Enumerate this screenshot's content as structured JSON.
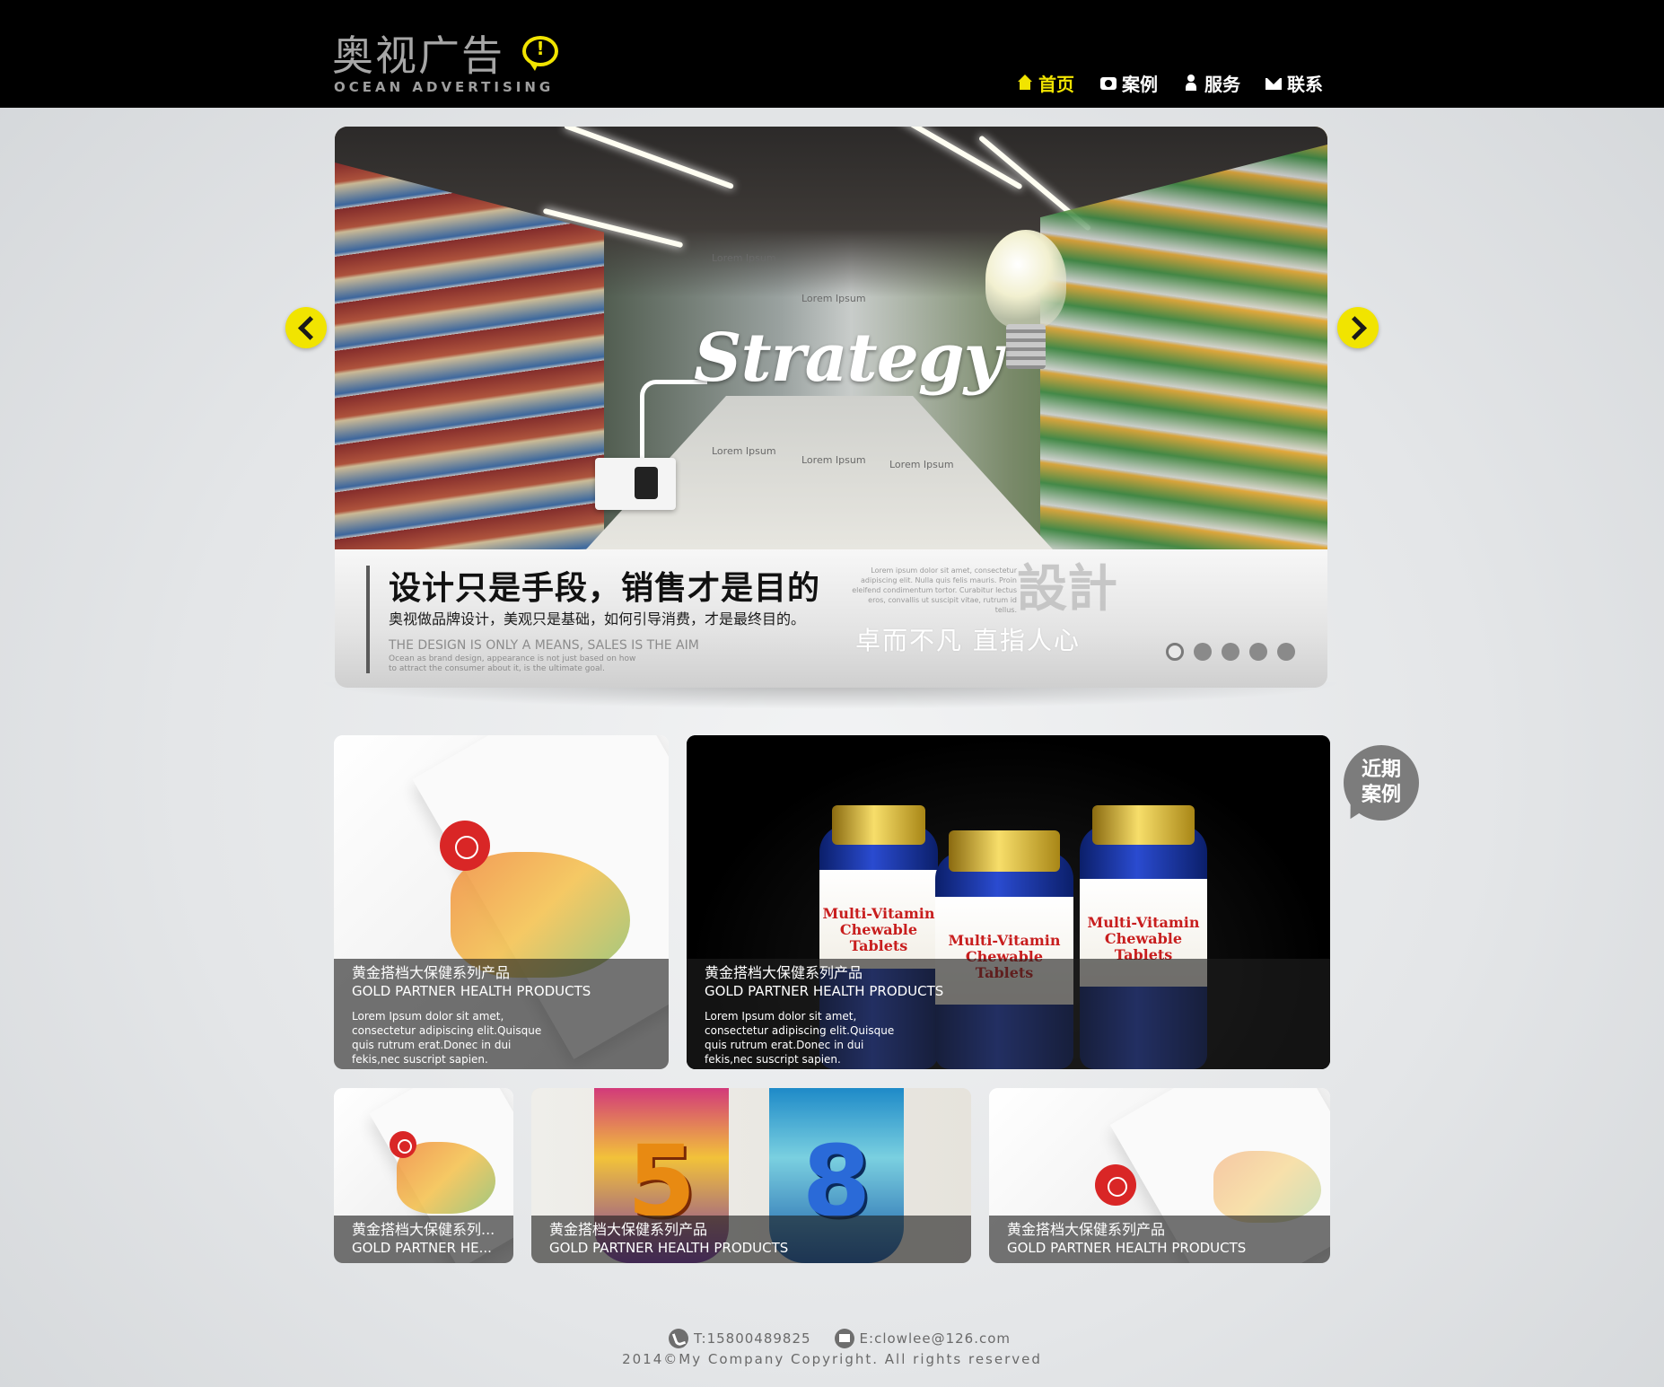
{
  "brand": {
    "name_cn": "奥视广告",
    "name_en": "OCEAN ADVERTISING",
    "bubble_mark": "!",
    "accent_color": "#f1e400"
  },
  "nav": [
    {
      "label": "首页",
      "icon": "home-icon",
      "active": true
    },
    {
      "label": "案例",
      "icon": "camera-icon",
      "active": false
    },
    {
      "label": "服务",
      "icon": "person-icon",
      "active": false
    },
    {
      "label": "联系",
      "icon": "mail-icon",
      "active": false
    }
  ],
  "slider": {
    "image_text": {
      "headline": "Strategy",
      "tag_1": "Lorem Ipsum",
      "tag_2": "Lorem Ipsum",
      "tag_3": "Lorem Ipsum",
      "tag_4": "Lorem Ipsum",
      "tag_5": "Lorem Ipsum"
    },
    "caption": {
      "title": "设计只是手段，销售才是目的",
      "subtitle": "奥视做品牌设计，美观只是基础，如何引导消费，才是最终目的。",
      "en_title": "THE DESIGN IS ONLY A MEANS, SALES IS THE AIM",
      "en_desc": "Ocean as brand design, appearance is not just based on how to attract the consumer about it, is the ultimate goal.",
      "lorem": "Lorem ipsum dolor sit amet, consectetur adipiscing elit. Nulla quis felis mauris. Proin eleifend condimentum tortor. Curabitur lectus eros, convallis ut suscipit vitae, rutrum id tellus.",
      "slogan": "卓而不凡 直指人心",
      "watermark": "設計"
    },
    "slide_count": 5,
    "active_slide": 1
  },
  "recent_badge": "近期案例",
  "cases": [
    {
      "title_cn": "黄金搭档大保健系列产品",
      "title_en": "GOLD PARTNER HEALTH PRODUCTS",
      "desc": "Lorem Ipsum dolor sit amet, consectetur adipiscing elit.Quisque quis rutrum erat.Donec in dui fekis,nec suscript sapien."
    },
    {
      "title_cn": "黄金搭档大保健系列产品",
      "title_en": "GOLD PARTNER HEALTH PRODUCTS",
      "desc": "Lorem Ipsum dolor sit amet, consectetur adipiscing elit.Quisque quis rutrum erat.Donec in dui fekis,nec suscript sapien."
    },
    {
      "title_cn": "黄金搭档大保健系列...",
      "title_en": "GOLD PARTNER HE..."
    },
    {
      "title_cn": "黄金搭档大保健系列产品",
      "title_en": "GOLD PARTNER HEALTH PRODUCTS"
    },
    {
      "title_cn": "黄金搭档大保健系列产品",
      "title_en": "GOLD PARTNER HEALTH PRODUCTS"
    }
  ],
  "case_art": {
    "bottle_label": "Multi-Vitamin Chewable Tablets",
    "drink_numbers": [
      "5",
      "8"
    ]
  },
  "footer": {
    "phone": "T:15800489825",
    "email": "E:clowlee@126.com",
    "copyright": "2014©My Company Copyright. All rights reserved"
  }
}
